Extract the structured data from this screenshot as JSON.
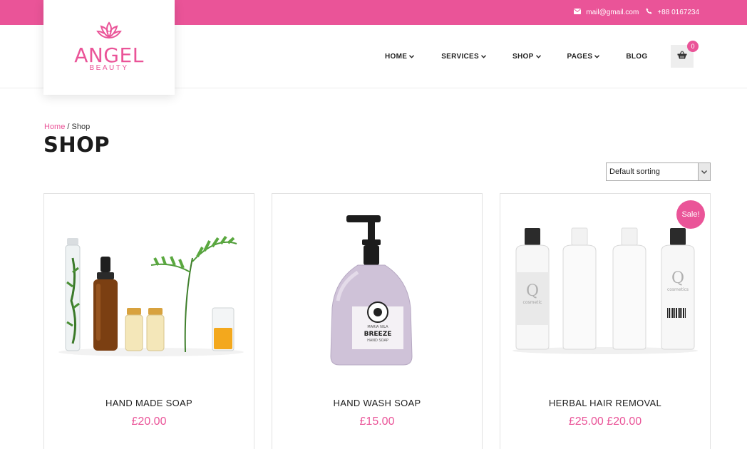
{
  "topbar": {
    "email": "mail@gmail.com",
    "phone": "+88 0167234"
  },
  "logo": {
    "name": "ANGEL",
    "tagline": "BEAUTY"
  },
  "nav": [
    {
      "label": "HOME",
      "has_dropdown": true
    },
    {
      "label": "SERVICES",
      "has_dropdown": true
    },
    {
      "label": "SHOP",
      "has_dropdown": true
    },
    {
      "label": "PAGES",
      "has_dropdown": true
    },
    {
      "label": "BLOG",
      "has_dropdown": false
    }
  ],
  "cart": {
    "count": "0"
  },
  "breadcrumb": {
    "home": "Home",
    "separator": " / ",
    "current": "Shop"
  },
  "page": {
    "title": "SHOP"
  },
  "sorting": {
    "selected": "Default sorting"
  },
  "products": [
    {
      "name": "HAND MADE SOAP",
      "price": "£20.00"
    },
    {
      "name": "HAND WASH SOAP",
      "price": "£15.00"
    },
    {
      "name": "HERBAL HAIR REMOVAL",
      "price": "£25.00 £20.00",
      "badge": "Sale!"
    }
  ],
  "colors": {
    "accent": "#ea5498"
  }
}
